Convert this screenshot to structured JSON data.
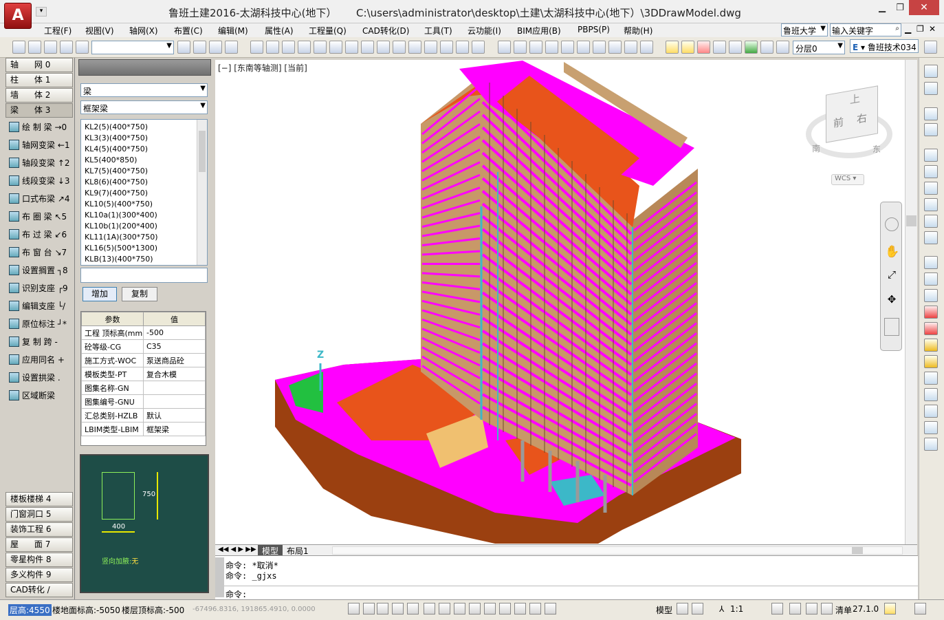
{
  "title": "鲁班土建2016-太湖科技中心(地下）      C:\\users\\administrator\\desktop\\土建\\太湖科技中心(地下）\\3DDrawModel.dwg",
  "menu": [
    "工程(F)",
    "视图(V)",
    "轴网(X)",
    "布置(C)",
    "编辑(M)",
    "属性(A)",
    "工程量(Q)",
    "CAD转化(D)",
    "工具(T)",
    "云功能(I)",
    "BIM应用(B)",
    "PBPS(P)",
    "帮助(H)"
  ],
  "search": {
    "product": "鲁班大学",
    "placeholder": "输入关键字"
  },
  "toolbar": {
    "layer": "分层0",
    "user": "鲁班技术034"
  },
  "left_tabs_top": [
    "轴      网 0",
    "柱      体 1",
    "墙      体 2",
    "梁      体 3"
  ],
  "left_cmds": [
    "绘 制 梁 →0",
    "轴网变梁 ←1",
    "轴段变梁 ↑2",
    "线段变梁 ↓3",
    "口式布梁 ↗4",
    "布 圈 梁 ↖5",
    "布 过 梁 ↙6",
    "布 窗 台 ↘7",
    "设置搁置 ┐8",
    "识别支座 ┌9",
    "编辑支座 └/",
    "原位标注 ┘*",
    "复 制 跨 -",
    "应用同名 +",
    "设置拱梁 .",
    "区域断梁"
  ],
  "left_tabs_bottom": [
    "楼板楼梯 4",
    "门窗洞口 5",
    "装饰工程 6",
    "屋      面 7",
    "零星构件 8",
    "多义构件 9",
    "CAD转化 /"
  ],
  "panel": {
    "category": "梁",
    "subtype": "框架梁",
    "items": [
      "KL2(5)(400*750)",
      "KL3(3)(400*750)",
      "KL4(5)(400*750)",
      "KL5(400*850)",
      "KL7(5)(400*750)",
      "KL8(6)(400*750)",
      "KL9(7)(400*750)",
      "KL10(5)(400*750)",
      "KL10a(1)(300*400)",
      "KL10b(1)(200*400)",
      "KL11(1A)(300*750)",
      "KL16(5)(500*1300)",
      "KLB(13)(400*750)"
    ],
    "add": "增加",
    "copy": "复制"
  },
  "props": {
    "headers": [
      "参数",
      "值"
    ],
    "rows": [
      [
        "工程 顶标高(mm",
        "-500"
      ],
      [
        "砼等级-CG",
        "C35"
      ],
      [
        "施工方式-WOC",
        "泵送商品砼"
      ],
      [
        "模板类型-PT",
        "复合木模"
      ],
      [
        "图集名称-GN",
        ""
      ],
      [
        "图集编号-GNU",
        ""
      ],
      [
        "汇总类别-HZLB",
        "默认"
      ],
      [
        "LBIM类型-LBIM",
        "框架梁"
      ]
    ]
  },
  "preview": {
    "height": "750",
    "width": "400",
    "note_label": "竖向加腋:",
    "note_value": "无"
  },
  "viewport": {
    "label": "[−] [东南等轴测] [当前]",
    "cube_top": "上",
    "cube_front": "前",
    "cube_right": "右",
    "compass_s": "南",
    "compass_e": "东",
    "wcs": "WCS",
    "axis_z": "Z"
  },
  "tabs": {
    "model": "模型",
    "layout": "布局1"
  },
  "command": {
    "line1": "命令: *取消*",
    "line2": "命令: _gjxs",
    "prompt": "命令:"
  },
  "status": {
    "floor_h": "层高:4550",
    "ground": "楼地面标高:-5050",
    "top": "楼层顶标高:-500",
    "coords": "-67496.8316, 191865.4910, 0.0000",
    "model": "模型",
    "scale": "1:1",
    "clear": "清单",
    "version": "27.1.0"
  },
  "colors": {
    "magenta": "#ff00ff",
    "orange": "#e8541b",
    "brown": "#9b4010",
    "tan": "#c89868",
    "cyan": "#3cb8c8",
    "dark_panel": "#1e4d47"
  }
}
